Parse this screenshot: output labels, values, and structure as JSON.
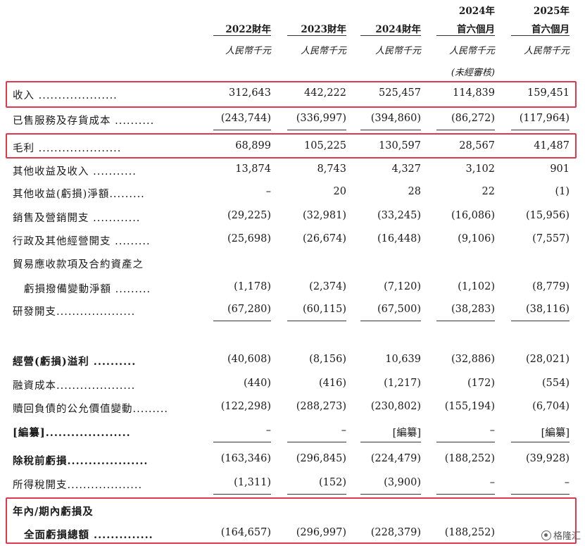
{
  "header": {
    "columns": [
      {
        "line1": "",
        "line2": "2022財年",
        "unit": "人民幣千元",
        "note": ""
      },
      {
        "line1": "",
        "line2": "2023財年",
        "unit": "人民幣千元",
        "note": ""
      },
      {
        "line1": "",
        "line2": "2024財年",
        "unit": "人民幣千元",
        "note": ""
      },
      {
        "line1": "2024年",
        "line2": "首六個月",
        "unit": "人民幣千元",
        "note": "(未經審核)"
      },
      {
        "line1": "2025年",
        "line2": "首六個月",
        "unit": "人民幣千元",
        "note": ""
      }
    ]
  },
  "rows": [
    {
      "label": "收入 ....................",
      "values": [
        "312,643",
        "442,222",
        "525,457",
        "114,839",
        "159,451"
      ],
      "bold": false,
      "indent": false
    },
    {
      "label": "已售服務及存貨成本 ..........",
      "values": [
        "(243,744)",
        "(336,997)",
        "(394,860)",
        "(86,272)",
        "(117,964)"
      ],
      "bold": false,
      "indent": false
    },
    {
      "label": "毛利 .....................",
      "values": [
        "68,899",
        "105,225",
        "130,597",
        "28,567",
        "41,487"
      ],
      "bold": false,
      "indent": false
    },
    {
      "label": "其他收益及收入 ...........",
      "values": [
        "13,874",
        "8,743",
        "4,327",
        "3,102",
        "901"
      ],
      "bold": false,
      "indent": false
    },
    {
      "label": "其他收益(虧損)淨額.........",
      "values": [
        "–",
        "20",
        "28",
        "22",
        "(1)"
      ],
      "bold": false,
      "indent": false
    },
    {
      "label": "銷售及營銷開支 ............",
      "values": [
        "(29,225)",
        "(32,981)",
        "(33,245)",
        "(16,086)",
        "(15,956)"
      ],
      "bold": false,
      "indent": false
    },
    {
      "label": "行政及其他經營開支 .........",
      "values": [
        "(25,698)",
        "(26,674)",
        "(16,448)",
        "(9,106)",
        "(7,557)"
      ],
      "bold": false,
      "indent": false
    },
    {
      "label": "貿易應收款項及合約資產之",
      "values": [
        "",
        "",
        "",
        "",
        ""
      ],
      "bold": false,
      "indent": false
    },
    {
      "label": "虧損撥備變動淨額 .........",
      "values": [
        "(1,178)",
        "(2,374)",
        "(7,120)",
        "(1,102)",
        "(8,779)"
      ],
      "bold": false,
      "indent": true
    },
    {
      "label": "研發開支....................",
      "values": [
        "(67,280)",
        "(60,115)",
        "(67,500)",
        "(38,283)",
        "(38,116)"
      ],
      "bold": false,
      "indent": false
    },
    {
      "label": "經營(虧損)溢利 ..........",
      "values": [
        "(40,608)",
        "(8,156)",
        "10,639",
        "(32,886)",
        "(28,021)"
      ],
      "bold": true,
      "indent": false
    },
    {
      "label": "融資成本....................",
      "values": [
        "(440)",
        "(416)",
        "(1,217)",
        "(172)",
        "(554)"
      ],
      "bold": false,
      "indent": false
    },
    {
      "label": "贖回負債的公允價值變動.........",
      "values": [
        "(122,298)",
        "(288,273)",
        "(230,802)",
        "(155,194)",
        "(6,704)"
      ],
      "bold": false,
      "indent": false
    },
    {
      "label": "[編纂]....................",
      "values": [
        "–",
        "–",
        "[編纂]",
        "–",
        "[編纂]"
      ],
      "bold": true,
      "indent": false
    },
    {
      "label": "除稅前虧損...................",
      "values": [
        "(163,346)",
        "(296,845)",
        "(224,479)",
        "(188,252)",
        "(39,928)"
      ],
      "bold": true,
      "indent": false
    },
    {
      "label": "所得稅開支...................",
      "values": [
        "(1,311)",
        "(152)",
        "(3,900)",
        "–",
        "–"
      ],
      "bold": false,
      "indent": false
    },
    {
      "label": "年內/期內虧損及",
      "values": [
        "",
        "",
        "",
        "",
        ""
      ],
      "bold": true,
      "indent": false
    },
    {
      "label": "全面虧損總額 ..............",
      "values": [
        "(164,657)",
        "(296,997)",
        "(228,379)",
        "(188,252)",
        ""
      ],
      "bold": true,
      "indent": true
    }
  ],
  "watermark": {
    "text": "格隆汇"
  },
  "colors": {
    "highlight": "#e0394f",
    "text": "#1a1a1a"
  }
}
